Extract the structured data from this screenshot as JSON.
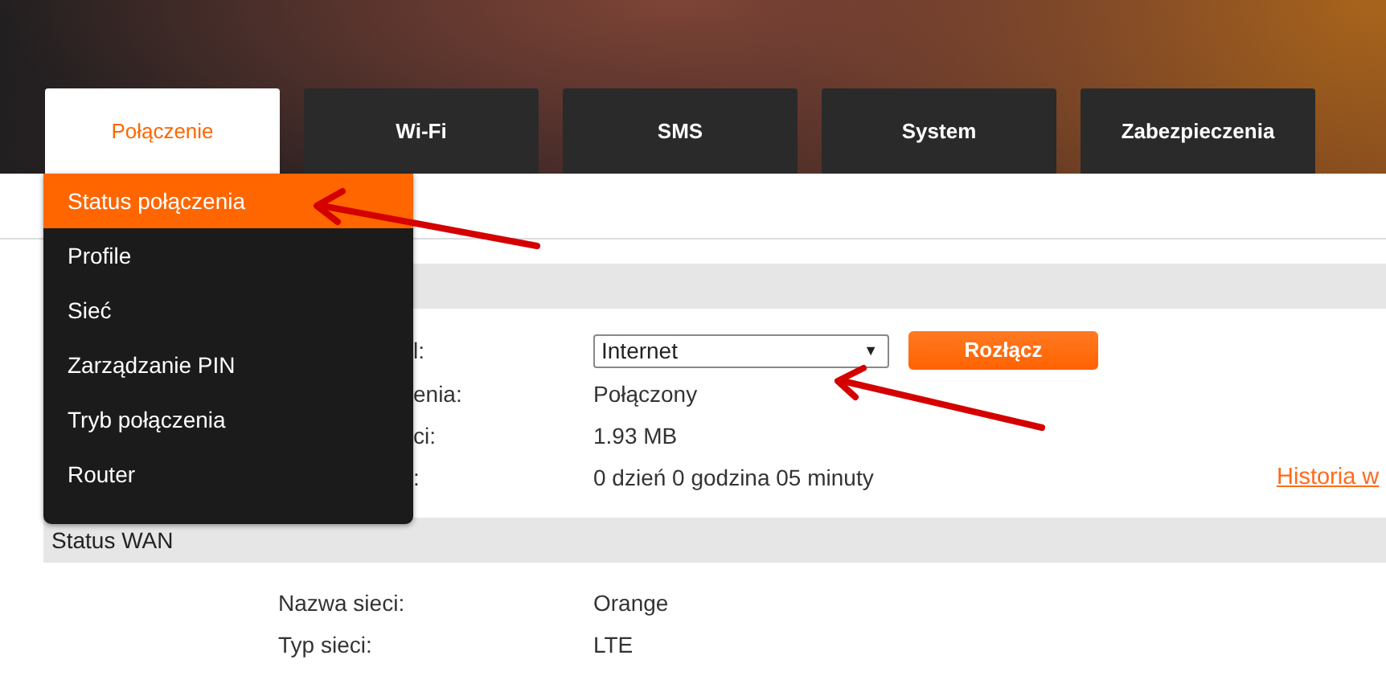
{
  "tabs": [
    {
      "label": "Połączenie",
      "selected": true
    },
    {
      "label": "Wi-Fi",
      "selected": false
    },
    {
      "label": "SMS",
      "selected": false
    },
    {
      "label": "System",
      "selected": false
    },
    {
      "label": "Zabezpieczenia",
      "selected": false
    }
  ],
  "submenu": [
    {
      "label": "Status połączenia",
      "selected": true
    },
    {
      "label": "Profile",
      "selected": false
    },
    {
      "label": "Sieć",
      "selected": false
    },
    {
      "label": "Zarządzanie PIN",
      "selected": false
    },
    {
      "label": "Tryb połączenia",
      "selected": false
    },
    {
      "label": "Router",
      "selected": false
    }
  ],
  "sections": [
    {
      "rows": [
        {
          "kind": "select",
          "label": "l:",
          "label_covered": true,
          "value": "Internet",
          "caret": "▼",
          "button": "Rozłącz"
        },
        {
          "kind": "text",
          "label": "enia:",
          "label_covered": true,
          "value": "Połączony"
        },
        {
          "kind": "text",
          "label": "ci:",
          "label_covered": true,
          "value": "1.93 MB"
        },
        {
          "kind": "text",
          "label": ":",
          "label_covered": true,
          "value": "0 dzień 0 godzina 05 minuty",
          "link": "Historia w"
        }
      ]
    },
    {
      "title": "Status WAN",
      "rows": [
        {
          "kind": "text",
          "label": "Nazwa sieci:",
          "value": "Orange"
        },
        {
          "kind": "text",
          "label": "Typ sieci:",
          "value": "LTE"
        }
      ]
    }
  ]
}
